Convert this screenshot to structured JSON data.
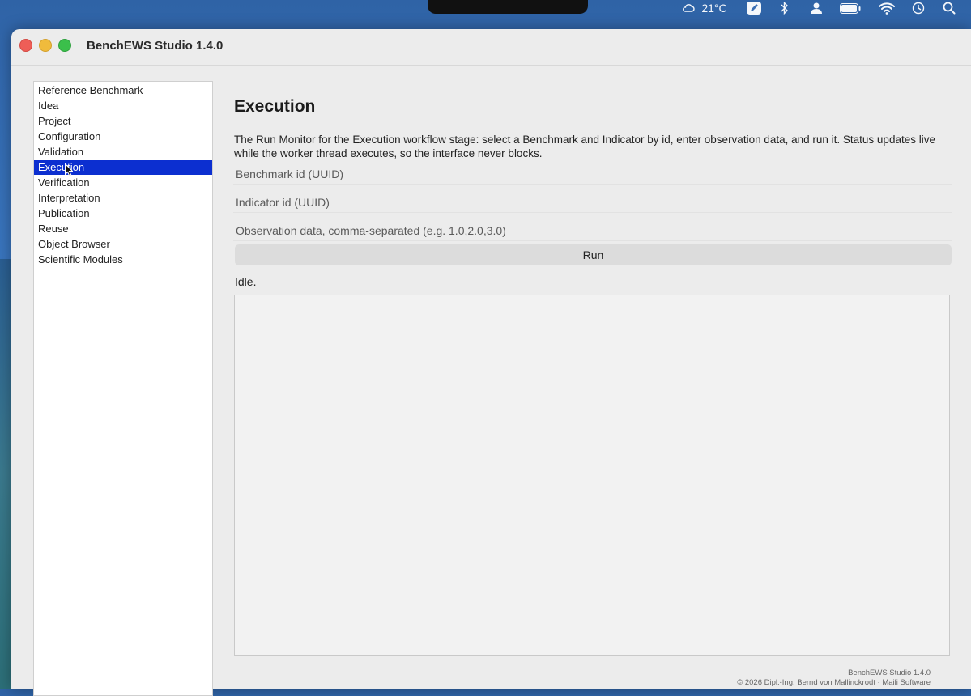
{
  "menubar": {
    "weather": "21°C",
    "icons": [
      "weather-icon",
      "pen-icon",
      "bluetooth-icon",
      "user-icon",
      "battery-icon",
      "wifi-icon",
      "time-machine-icon",
      "search-icon"
    ]
  },
  "window": {
    "title": "BenchEWS Studio 1.4.0"
  },
  "sidebar": {
    "items": [
      {
        "label": "Reference Benchmark"
      },
      {
        "label": "Idea"
      },
      {
        "label": "Project"
      },
      {
        "label": "Configuration"
      },
      {
        "label": "Validation"
      },
      {
        "label": "Execution",
        "selected": true
      },
      {
        "label": "Verification"
      },
      {
        "label": "Interpretation"
      },
      {
        "label": "Publication"
      },
      {
        "label": "Reuse"
      },
      {
        "label": "Object Browser"
      },
      {
        "label": "Scientific Modules"
      }
    ]
  },
  "main": {
    "title": "Execution",
    "description": "The Run Monitor for the Execution workflow stage: select a Benchmark and Indicator by id, enter observation data, and run it. Status updates live while the worker thread executes, so the interface never blocks.",
    "benchmark_placeholder": "Benchmark id (UUID)",
    "indicator_placeholder": "Indicator id (UUID)",
    "observation_placeholder": "Observation data, comma-separated (e.g. 1.0,2.0,3.0)",
    "run_label": "Run",
    "status": "Idle."
  },
  "footer": {
    "line1": "BenchEWS Studio 1.4.0",
    "line2": "© 2026 Dipl.-Ing. Bernd von Mallinckrodt · Maili Software"
  },
  "colors": {
    "selection": "#0c2fd0",
    "window_bg": "#ececec"
  }
}
